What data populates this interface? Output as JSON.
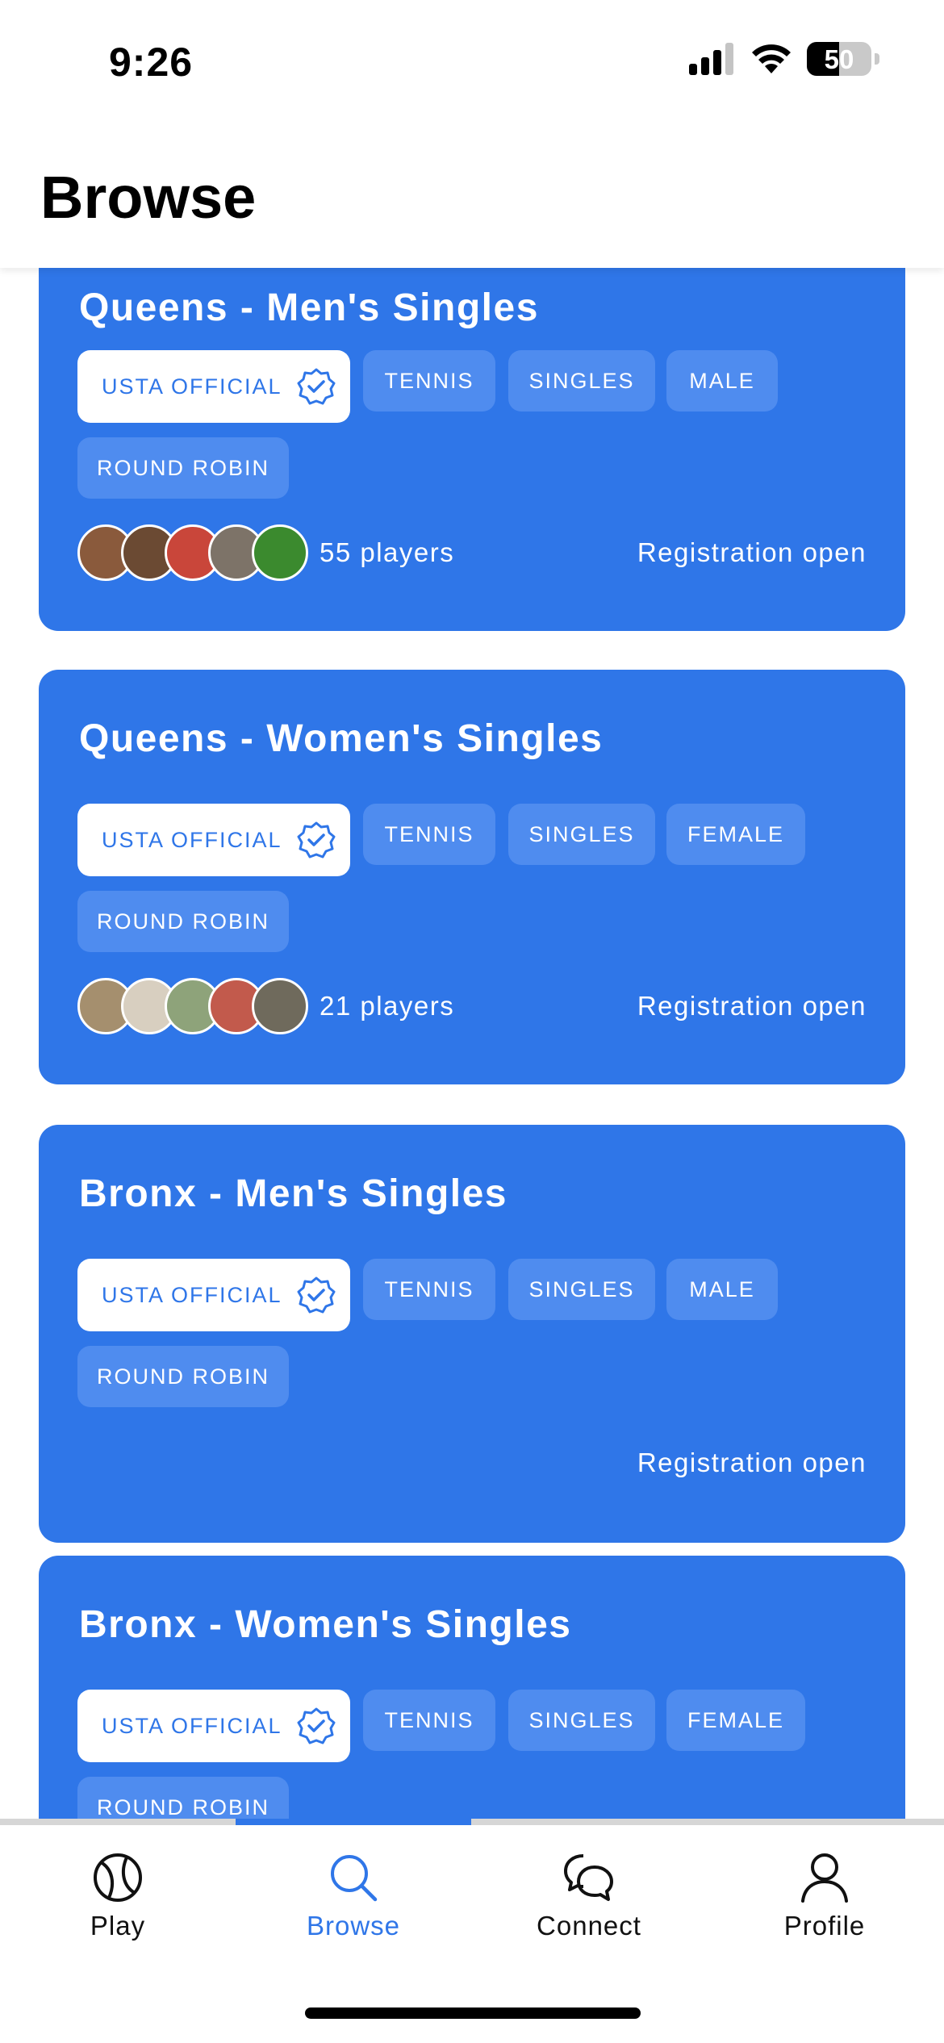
{
  "status_bar": {
    "time": "9:26",
    "battery_level": "50"
  },
  "header": {
    "title": "Browse"
  },
  "cards": [
    {
      "title": "Queens - Men's Singles",
      "official_label": "USTA OFFICIAL",
      "tags": [
        "TENNIS",
        "SINGLES",
        "MALE",
        "ROUND ROBIN"
      ],
      "players": "55 players",
      "status": "Registration open"
    },
    {
      "title": "Queens - Women's Singles",
      "official_label": "USTA OFFICIAL",
      "tags": [
        "TENNIS",
        "SINGLES",
        "FEMALE",
        "ROUND ROBIN"
      ],
      "players": "21 players",
      "status": "Registration open"
    },
    {
      "title": "Bronx - Men's Singles",
      "official_label": "USTA OFFICIAL",
      "tags": [
        "TENNIS",
        "SINGLES",
        "MALE",
        "ROUND ROBIN"
      ],
      "status": "Registration open"
    },
    {
      "title": "Bronx - Women's Singles",
      "official_label": "USTA OFFICIAL",
      "tags": [
        "TENNIS",
        "SINGLES",
        "FEMALE",
        "ROUND ROBIN"
      ]
    }
  ],
  "avatars": {
    "card0": [
      "#8a5a3c",
      "#6b4a33",
      "#c9463a",
      "#7d7368",
      "#3b8a2e"
    ],
    "card1": [
      "#a58f6e",
      "#d8cfc0",
      "#8ea37a",
      "#c25a4c",
      "#6f6a5c"
    ]
  },
  "tab_bar": {
    "tabs": [
      {
        "label": "Play",
        "icon": "tennis-ball-icon"
      },
      {
        "label": "Browse",
        "icon": "search-icon"
      },
      {
        "label": "Connect",
        "icon": "chat-bubbles-icon"
      },
      {
        "label": "Profile",
        "icon": "person-icon"
      }
    ],
    "active_tab": "Browse"
  },
  "colors": {
    "accent": "#2f76e8",
    "card": "#2f76e8",
    "tag": "#4f8cef"
  }
}
